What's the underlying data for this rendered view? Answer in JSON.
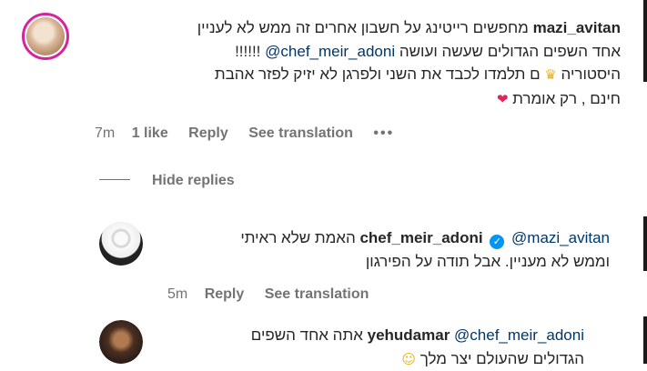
{
  "comment1": {
    "username": "mazi_avitan",
    "line1": "מחפשים רייטינג על חשבון אחרים זה ממש לא לעניין",
    "line2_mention": "chef_meir_adoni@",
    "line2_text": "אחד השפים הגדולים שעשה ועושה",
    "line2_marks": "!!!!!!",
    "line3_a": "היסטוריה",
    "line3_b": "ם תלמדו לכבד את השני ולפרגן לא יזיק לפזר אהבת",
    "line4": "חינם , רק אומרת",
    "emoji_crown": "♛",
    "emoji_heart": "❤",
    "time": "7m",
    "likes": "1 like",
    "reply": "Reply",
    "see_translation": "See translation",
    "more": "•••"
  },
  "hide_replies": "Hide replies",
  "comment2": {
    "username": "chef_meir_adoni",
    "verified_mark": "✓",
    "mention": "@mazi_avitan",
    "line1_text": "האמת שלא ראיתי",
    "line2": "וממש לא מעניין. אבל תודה על הפירגון",
    "time": "5m",
    "reply": "Reply",
    "see_translation": "See translation"
  },
  "comment3": {
    "username": "yehudamar",
    "mention": "@chef_meir_adoni",
    "line1_text": "אתה אחד השפים",
    "line2": "הגדולים שהעולם יצר מלך",
    "emoji_face": "☺"
  }
}
